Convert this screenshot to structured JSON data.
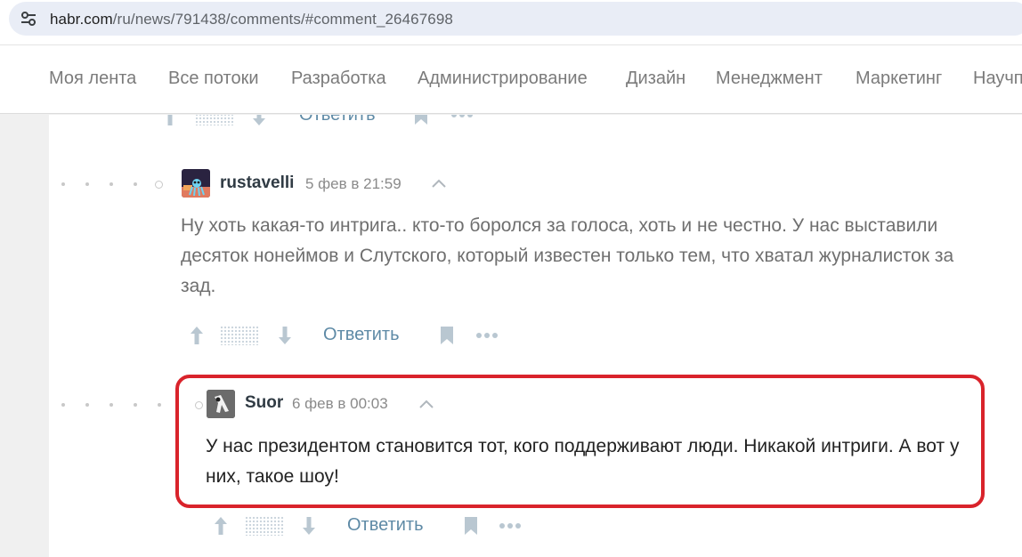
{
  "browser": {
    "url_host": "habr.com",
    "url_path": "/ru/news/791438/comments/#comment_26467698"
  },
  "nav": {
    "items": [
      "Моя лента",
      "Все потоки",
      "Разработка",
      "Администрирование",
      "Дизайн",
      "Менеджмент",
      "Маркетинг",
      "Научпоп"
    ]
  },
  "comments": [
    {
      "username": "rustavelli",
      "timestamp": "5 фев в 21:59",
      "text": "Ну хоть какая-то интрига.. кто-то боролся за голоса, хоть и не честно. У нас выставили десяток нонеймов и Слутского, который известен только тем, что хватал журналисток за зад.",
      "reply_label": "Ответить"
    },
    {
      "username": "Suor",
      "timestamp": "6 фев в 00:03",
      "text": "У нас президентом становится тот, кого поддерживают люди. Никакой интриги. А вот у них, такое шоу!",
      "reply_label": "Ответить"
    }
  ],
  "previous_comment": {
    "reply_label": "Ответить"
  },
  "colors": {
    "highlight": "#d9232b",
    "reply_link": "#5e8aa6",
    "text_muted": "#6f6f6f",
    "text_main": "#222222"
  }
}
